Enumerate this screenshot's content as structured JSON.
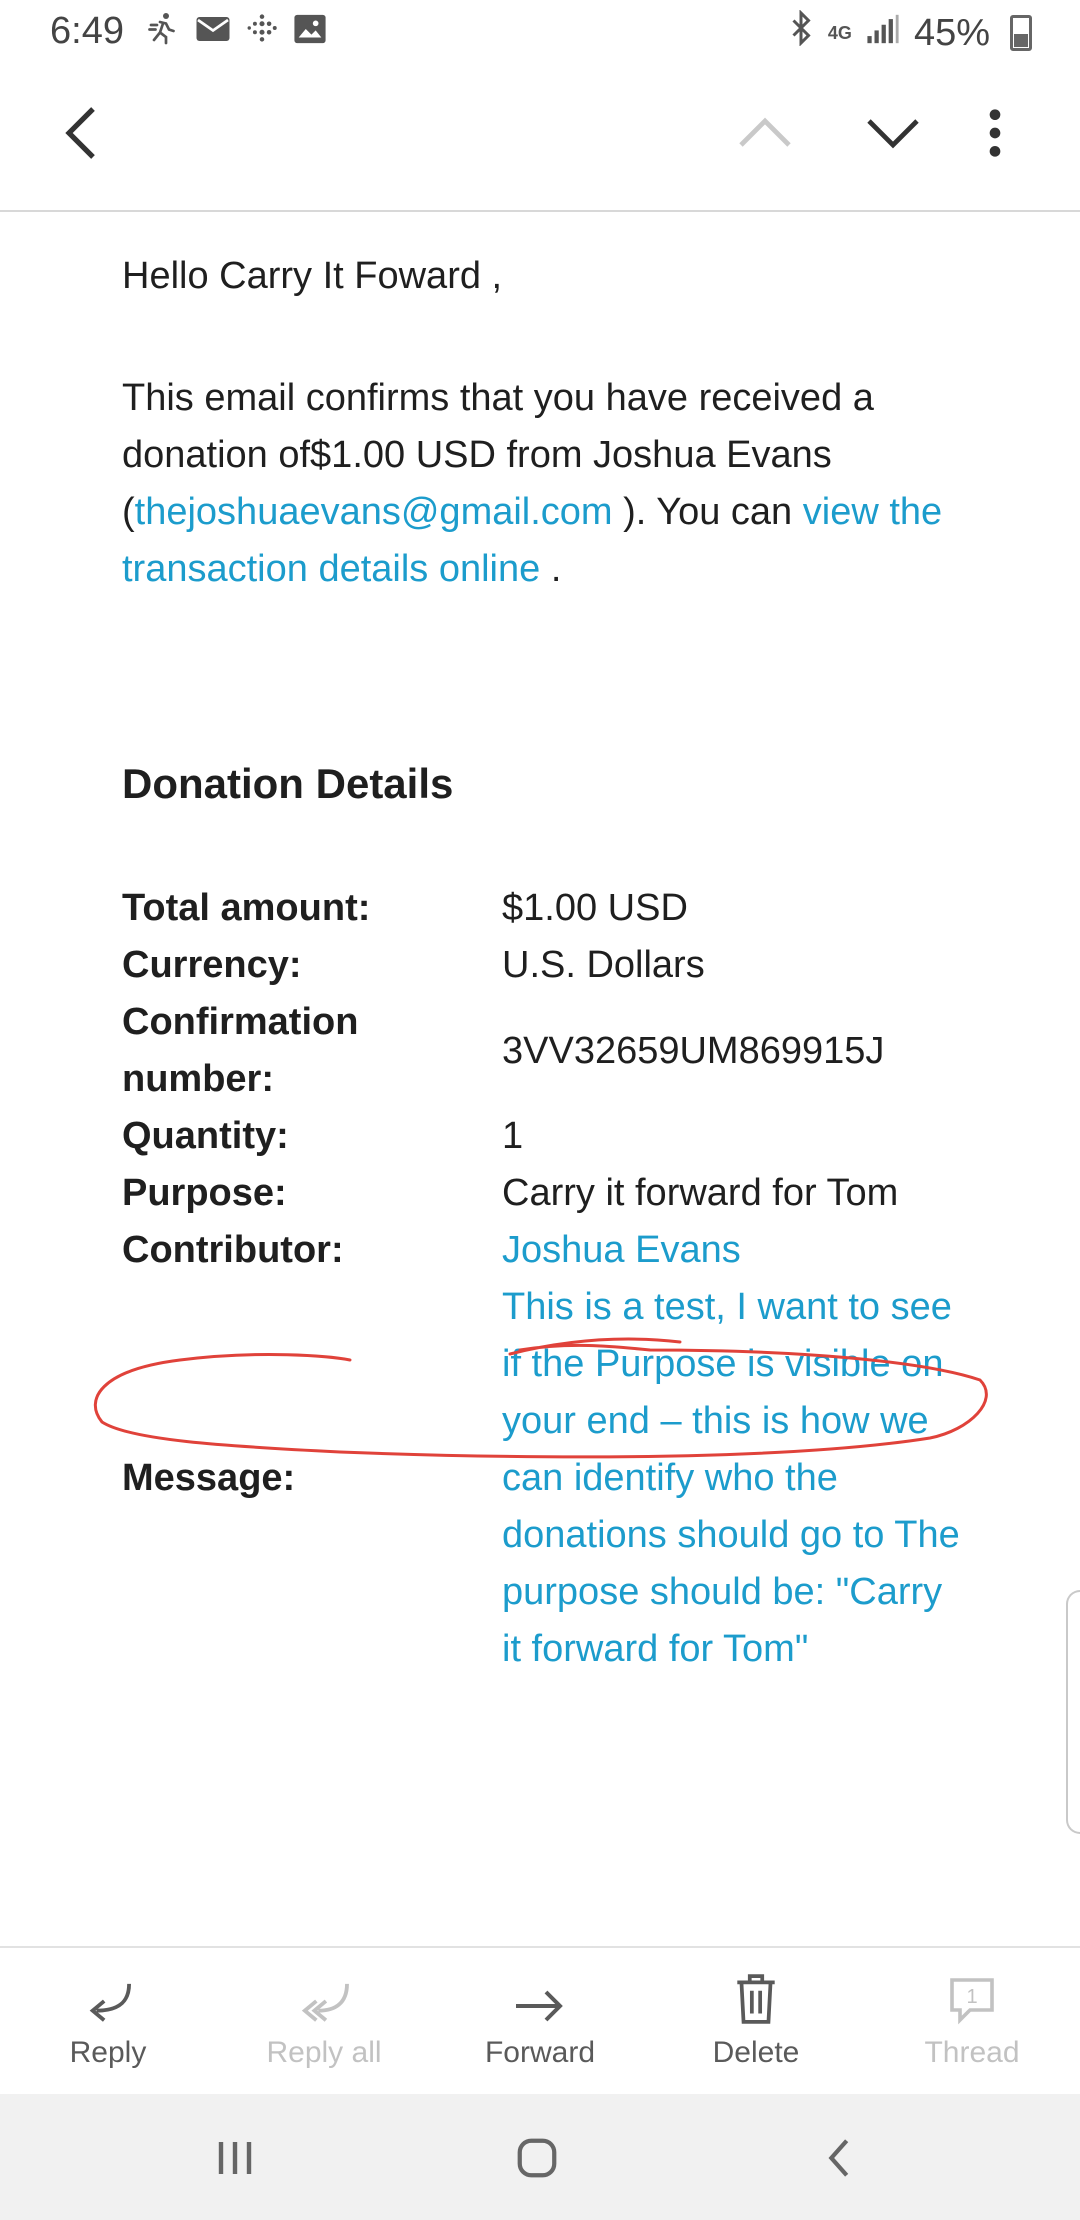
{
  "status_bar": {
    "time": "6:49",
    "left_icons": [
      "running-icon",
      "mail-icon",
      "fitbit-icon",
      "image-icon"
    ],
    "network": "4G",
    "battery": "45%"
  },
  "toolbar": {
    "back_icon": "chevron-left-icon",
    "prev_icon": "chevron-up-icon",
    "next_icon": "chevron-down-icon",
    "more_icon": "more-vertical-icon"
  },
  "email": {
    "greeting": "Hello Carry It Foward ,",
    "intro_part1": "This email confirms that you have received a donation of$1.00 USD from Joshua Evans (",
    "sender_email": "thejoshuaevans@gmail.com",
    "intro_part2": " ). You can ",
    "details_link": "view the transaction details online",
    "intro_part3": " .",
    "section_title": "Donation Details",
    "details": {
      "total_label": "Total amount:",
      "total_value": "$1.00 USD",
      "currency_label": "Currency:",
      "currency_value": "U.S. Dollars",
      "confirmation_label": "Confirmation number:",
      "confirmation_value": "3VV32659UM869915J",
      "quantity_label": "Quantity:",
      "quantity_value": "1",
      "purpose_label": "Purpose:",
      "purpose_value": "Carry it forward for Tom",
      "contributor_label": "Contributor:",
      "contributor_value": "Joshua Evans",
      "message_label": "Message:",
      "message_value": "This is a test, I want to see if the Purpose is visible on your end – this is how we can identify who the donations should go to The purpose should be: \"Carry it forward for Tom\""
    }
  },
  "actions": {
    "reply": "Reply",
    "reply_all": "Reply all",
    "forward": "Forward",
    "delete": "Delete",
    "thread": "Thread",
    "thread_count": "1"
  },
  "colors": {
    "link": "#1c9ccc",
    "annotation": "#e0423a"
  }
}
